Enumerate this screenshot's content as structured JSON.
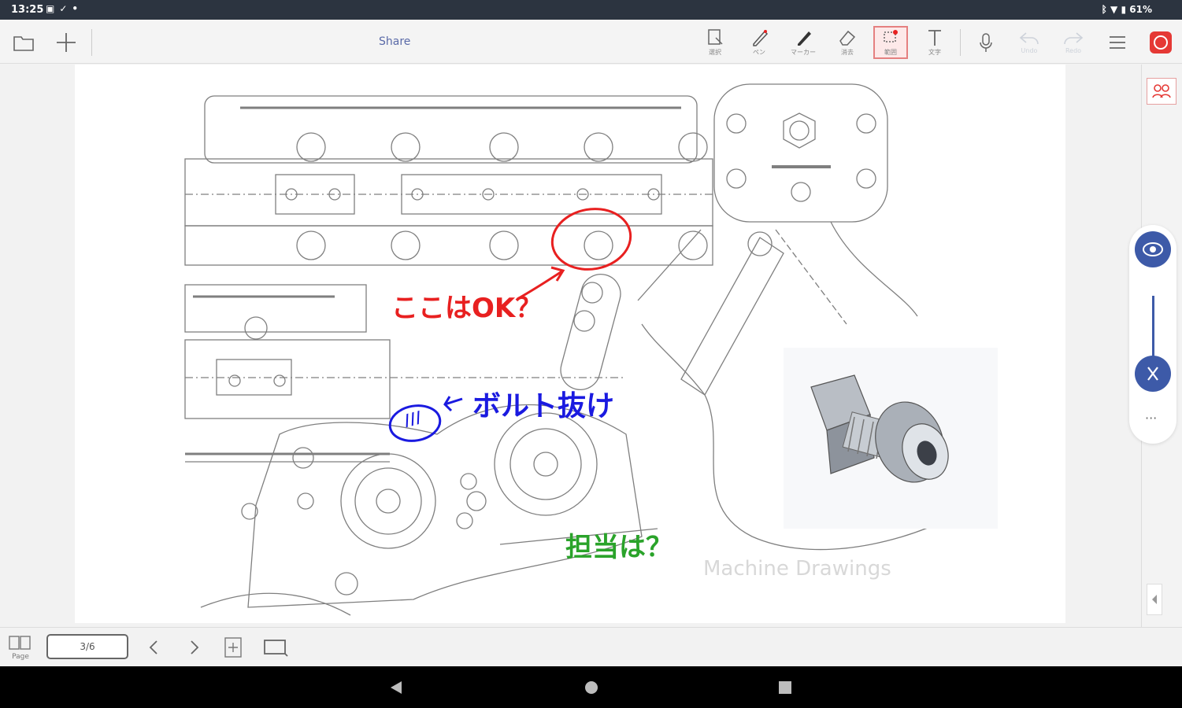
{
  "status_bar": {
    "time": "13:25",
    "left_icons": [
      "message-icon",
      "check-icon",
      "dot-icon"
    ],
    "battery": "61%"
  },
  "toolbar": {
    "share_label": "Share",
    "tools": [
      {
        "name": "select-tool",
        "label": "選択"
      },
      {
        "name": "pen-tool",
        "label": "ペン"
      },
      {
        "name": "marker-tool",
        "label": "マーカー"
      },
      {
        "name": "eraser-tool",
        "label": "消去"
      },
      {
        "name": "lasso-tool",
        "label": "範囲"
      },
      {
        "name": "text-tool",
        "label": "文字"
      }
    ],
    "undo_label": "Undo",
    "redo_label": "Redo"
  },
  "canvas": {
    "annotations": {
      "red_note": "ここはOK？",
      "blue_note": "ボルト抜け",
      "green_note": "担当は？",
      "blue_circle_text": "///"
    },
    "watermark": "Machine Drawings"
  },
  "bottom_bar": {
    "page_label": "Page",
    "page_indicator": "3/6"
  },
  "colors": {
    "red_ink": "#e82020",
    "blue_ink": "#1a1ae0",
    "green_ink": "#2aa32a",
    "accent_circle": "#3d5aa8",
    "record_button": "#e53935"
  }
}
